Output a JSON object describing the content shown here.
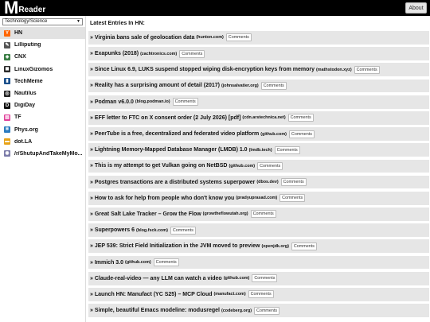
{
  "header": {
    "logo_initial": "M",
    "logo_rest": "Reader",
    "about_label": "About"
  },
  "sidebar": {
    "category_selected": "Technology/Science",
    "feeds": [
      {
        "label": "HN",
        "icon": "hn-icon",
        "glyph": "Y",
        "color": "#ff6600",
        "active": true
      },
      {
        "label": "Lilliputing",
        "icon": "lilliputing-icon",
        "glyph": "✎",
        "color": "#555555",
        "active": false
      },
      {
        "label": "CNX",
        "icon": "cnx-icon",
        "glyph": "◈",
        "color": "#3a7d44",
        "active": false
      },
      {
        "label": "LinuxGizomos",
        "icon": "linuxgizmos-icon",
        "glyph": "◼",
        "color": "#2a2a2a",
        "active": false
      },
      {
        "label": "TechMeme",
        "icon": "techmeme-icon",
        "glyph": "▮",
        "color": "#1a4f8b",
        "active": false
      },
      {
        "label": "Nautilus",
        "icon": "nautilus-icon",
        "glyph": "◎",
        "color": "#222222",
        "active": false
      },
      {
        "label": "DigiDay",
        "icon": "digiday-icon",
        "glyph": "D",
        "color": "#111111",
        "active": false
      },
      {
        "label": "TF",
        "icon": "tf-icon",
        "glyph": "▤",
        "color": "#e0409a",
        "active": false
      },
      {
        "label": "Phys.org",
        "icon": "physorg-icon",
        "glyph": "⚛",
        "color": "#2c7bc0",
        "active": false
      },
      {
        "label": "dot.LA",
        "icon": "dotla-icon",
        "glyph": "▬",
        "color": "#e8a317",
        "active": false
      },
      {
        "label": "/r/ShutupAndTakeMyMo...",
        "icon": "reddit-icon",
        "glyph": "◉",
        "color": "#7a7aa8",
        "active": false
      }
    ]
  },
  "main": {
    "title": "Latest Entries In HN:",
    "comments_label": "Comments",
    "entries": [
      {
        "title": "» Virginia bans sale of geolocation data",
        "domain": "(hunton.com)"
      },
      {
        "title": "» Exapunks (2018)",
        "domain": "(zachtronics.com)"
      },
      {
        "title": "» Since Linux 6.9, LUKS suspend stopped wiping disk-encryption keys from memory",
        "domain": "(mathstodon.xyz)"
      },
      {
        "title": "» Reality has a surprising amount of detail (2017)",
        "domain": "(johnsalvatier.org)"
      },
      {
        "title": "» Podman v6.0.0",
        "domain": "(blog.podman.io)"
      },
      {
        "title": "» EFF letter to FTC on X consent order (2 July 2026) [pdf]",
        "domain": "(cdn.arstechnica.net)"
      },
      {
        "title": "» PeerTube is a free, decentralized and federated video platform",
        "domain": "(github.com)"
      },
      {
        "title": "» Lightning Memory-Mapped Database Manager (LMDB) 1.0",
        "domain": "(lmdb.tech)"
      },
      {
        "title": "» This is my attempt to get Vulkan going on NetBSD",
        "domain": "(github.com)"
      },
      {
        "title": "» Postgres transactions are a distributed systems superpower",
        "domain": "(dbos.dev)"
      },
      {
        "title": "» How to ask for help from people who don't know you",
        "domain": "(pradyuprasad.com)"
      },
      {
        "title": "» Great Salt Lake Tracker – Grow the Flow",
        "domain": "(growtheflowutah.org)"
      },
      {
        "title": "» Superpowers 6",
        "domain": "(blog.fsck.com)"
      },
      {
        "title": "» JEP 539: Strict Field Initialization in the JVM moved to preview",
        "domain": "(openjdk.org)"
      },
      {
        "title": "» Immich 3.0",
        "domain": "(github.com)"
      },
      {
        "title": "» Claude-real-video — any LLM can watch a video",
        "domain": "(github.com)"
      },
      {
        "title": "» Launch HN: Manufact (YC S25) – MCP Cloud",
        "domain": "(manufact.com)"
      },
      {
        "title": "» Simple, beautiful Emacs modeline: modusregel",
        "domain": "(codeberg.org)"
      }
    ]
  }
}
